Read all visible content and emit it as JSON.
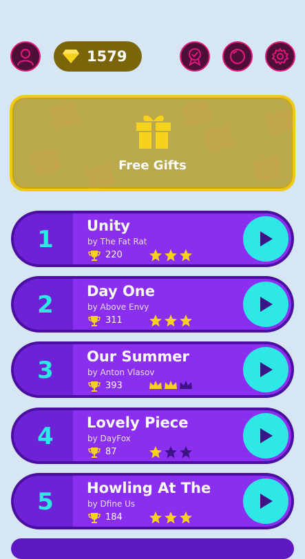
{
  "header": {
    "gems": "1579"
  },
  "gift_panel": {
    "label": "Free Gifts"
  },
  "songs": [
    {
      "number": "1",
      "title": "Unity",
      "artist": "by The Fat Rat",
      "score": "220",
      "stars": 3,
      "icon": "star"
    },
    {
      "number": "2",
      "title": "Day One",
      "artist": "by Above Envy",
      "score": "311",
      "stars": 3,
      "icon": "star"
    },
    {
      "number": "3",
      "title": "Our Summer",
      "artist": "by Anton Vlasov",
      "score": "393",
      "stars": 2,
      "icon": "crown"
    },
    {
      "number": "4",
      "title": "Lovely Piece",
      "artist": "by DayFox",
      "score": "87",
      "stars": 1,
      "icon": "star"
    },
    {
      "number": "5",
      "title": "Howling At The",
      "artist": "by Dfine Us",
      "score": "184",
      "stars": 3,
      "icon": "star"
    }
  ],
  "colors": {
    "accent_cyan": "#2ee8e6",
    "card_purple": "#8a2ff0",
    "gold": "#f7d21c",
    "pink_ring": "#e0187a"
  }
}
